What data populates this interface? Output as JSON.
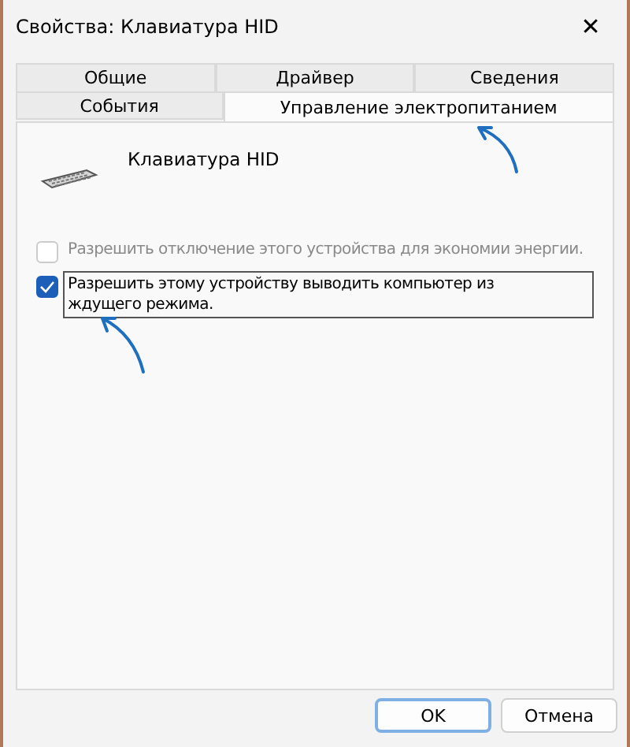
{
  "window": {
    "title": "Свойства: Клавиатура HID",
    "close": "✕"
  },
  "tab_rows": [
    [
      {
        "label": "Общие",
        "selected": false
      },
      {
        "label": "Драйвер",
        "selected": false
      },
      {
        "label": "Сведения",
        "selected": false
      }
    ],
    [
      {
        "label": "События",
        "selected": false
      },
      {
        "label": "Управление электропитанием",
        "selected": true
      }
    ]
  ],
  "device": {
    "name": "Клавиатура HID"
  },
  "options": [
    {
      "label": "Разрешить отключение этого устройства для экономии энергии.",
      "checked": false,
      "disabled": true,
      "focused": false
    },
    {
      "label": "Разрешить этому устройству выводить компьютер из ждущего режима.",
      "checked": true,
      "disabled": false,
      "focused": true
    }
  ],
  "buttons": [
    {
      "label": "OK",
      "default": true
    },
    {
      "label": "Отмена",
      "default": false
    }
  ]
}
